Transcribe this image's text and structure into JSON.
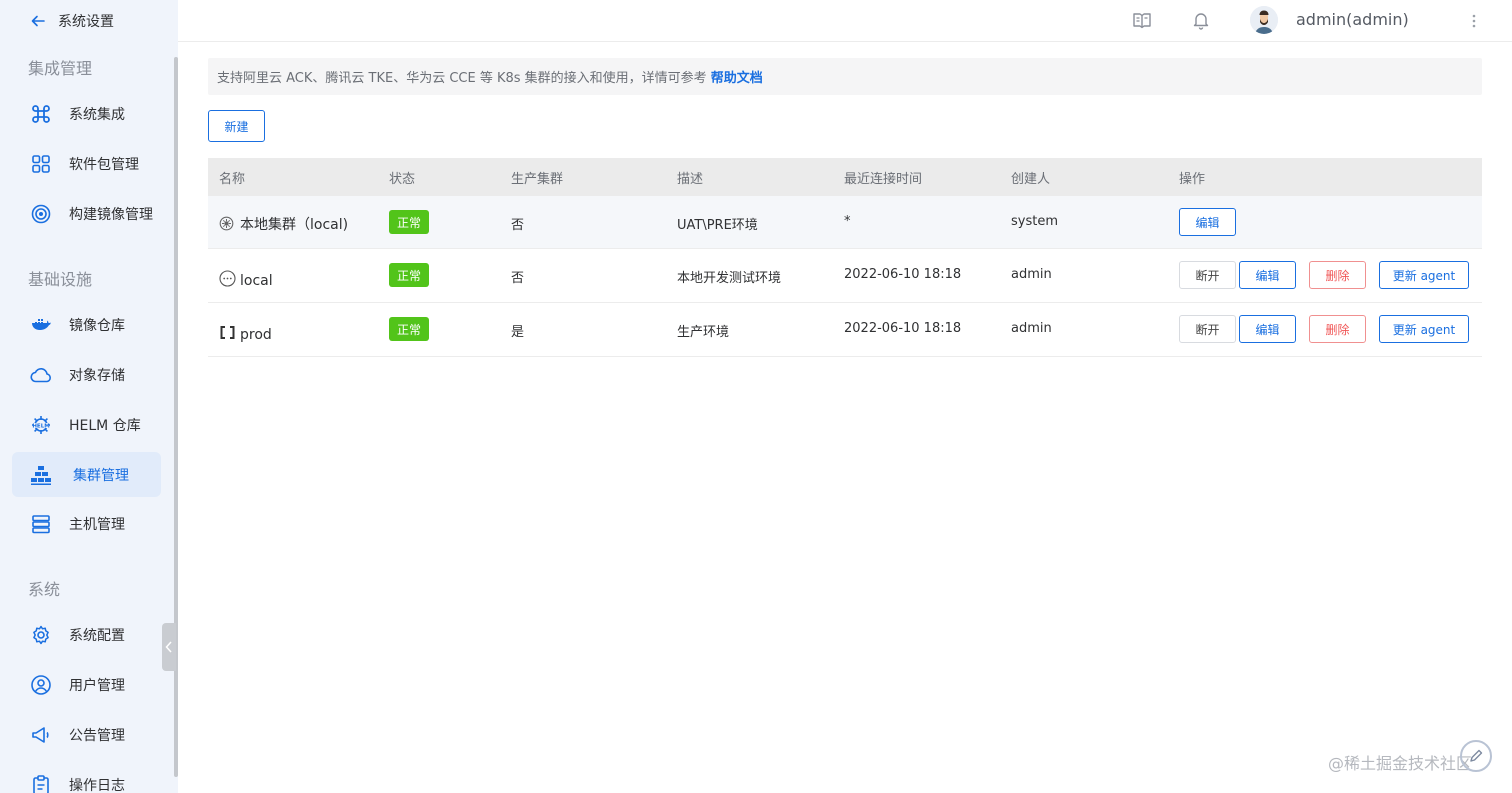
{
  "sidebar": {
    "back_label": "系统设置",
    "groups": [
      {
        "title": "集成管理"
      },
      {
        "title": "基础设施"
      },
      {
        "title": "系统"
      }
    ],
    "items": [
      {
        "label": "系统集成",
        "icon": "command-icon"
      },
      {
        "label": "软件包管理",
        "icon": "grid-icon"
      },
      {
        "label": "构建镜像管理",
        "icon": "target-icon"
      },
      {
        "label": "镜像仓库",
        "icon": "docker-icon"
      },
      {
        "label": "对象存储",
        "icon": "cloud-icon"
      },
      {
        "label": "HELM 仓库",
        "icon": "helm-icon"
      },
      {
        "label": "集群管理",
        "icon": "cluster-icon",
        "active": true
      },
      {
        "label": "主机管理",
        "icon": "server-icon"
      },
      {
        "label": "系统配置",
        "icon": "gear-icon"
      },
      {
        "label": "用户管理",
        "icon": "user-icon"
      },
      {
        "label": "公告管理",
        "icon": "megaphone-icon"
      },
      {
        "label": "操作日志",
        "icon": "clipboard-icon"
      }
    ]
  },
  "header": {
    "username": "admin(admin)",
    "icons": [
      "book-icon",
      "bell-icon",
      "more-icon"
    ]
  },
  "tip": {
    "text": "支持阿里云 ACK、腾讯云 TKE、华为云 CCE 等 K8s 集群的接入和使用，详情可参考",
    "link": "帮助文档"
  },
  "new_button": "新建",
  "table": {
    "columns": [
      "名称",
      "状态",
      "生产集群",
      "描述",
      "最近连接时间",
      "创建人",
      "操作"
    ],
    "rows": [
      {
        "name": "本地集群（local)",
        "icon": "helm-wheel-icon",
        "status": "正常",
        "production": "否",
        "description": "UAT\\PRE环境",
        "last_connected": "*",
        "creator": "system",
        "actions": [
          "编辑"
        ]
      },
      {
        "name": "local",
        "icon": "dots-circle-icon",
        "status": "正常",
        "production": "否",
        "description": "本地开发测试环境",
        "last_connected": "2022-06-10 18:18",
        "creator": "admin",
        "actions": [
          "断开",
          "编辑",
          "删除",
          "更新 agent"
        ]
      },
      {
        "name": "prod",
        "icon": "bracket-icon",
        "status": "正常",
        "production": "是",
        "description": "生产环境",
        "last_connected": "2022-06-10 18:18",
        "creator": "admin",
        "actions": [
          "断开",
          "编辑",
          "删除",
          "更新 agent"
        ]
      }
    ]
  },
  "watermark": "@稀土掘金技术社区",
  "colors": {
    "accent": "#1a6fe0",
    "success": "#52c41a",
    "danger": "#f05656",
    "sidebar_bg": "#f0f4fb"
  }
}
